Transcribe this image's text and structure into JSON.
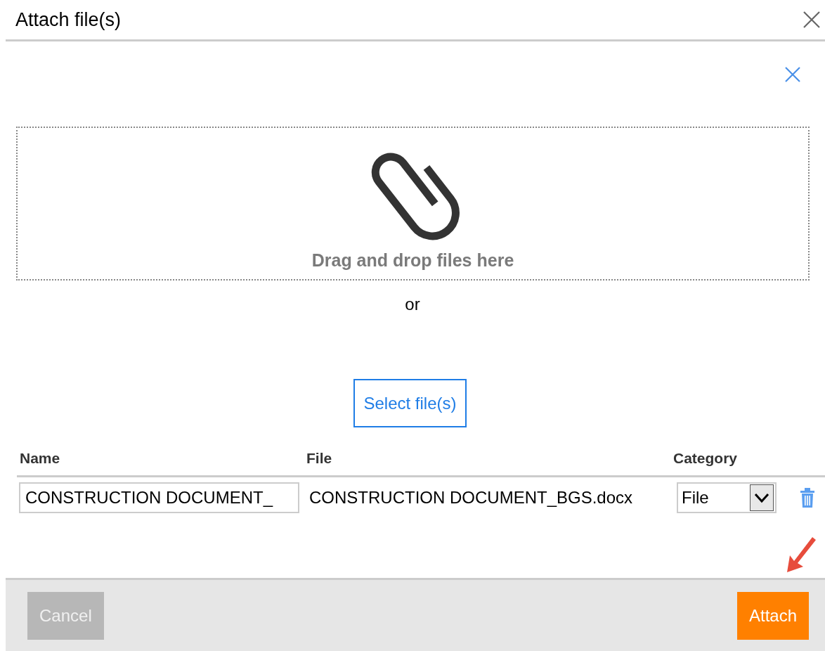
{
  "dialog": {
    "title": "Attach file(s)"
  },
  "dropzone": {
    "text": "Drag and drop files here"
  },
  "separator": "or",
  "select_button": "Select file(s)",
  "table": {
    "columns": [
      "Name",
      "File",
      "Category"
    ],
    "rows": [
      {
        "name": "CONSTRUCTION DOCUMENT_",
        "file": "CONSTRUCTION DOCUMENT_BGS.docx",
        "category": "File"
      }
    ]
  },
  "buttons": [
    {
      "label": "Cancel",
      "kind": "cancel",
      "disabled": true
    },
    {
      "label": "Attach",
      "kind": "primary",
      "disabled": false
    }
  ]
}
